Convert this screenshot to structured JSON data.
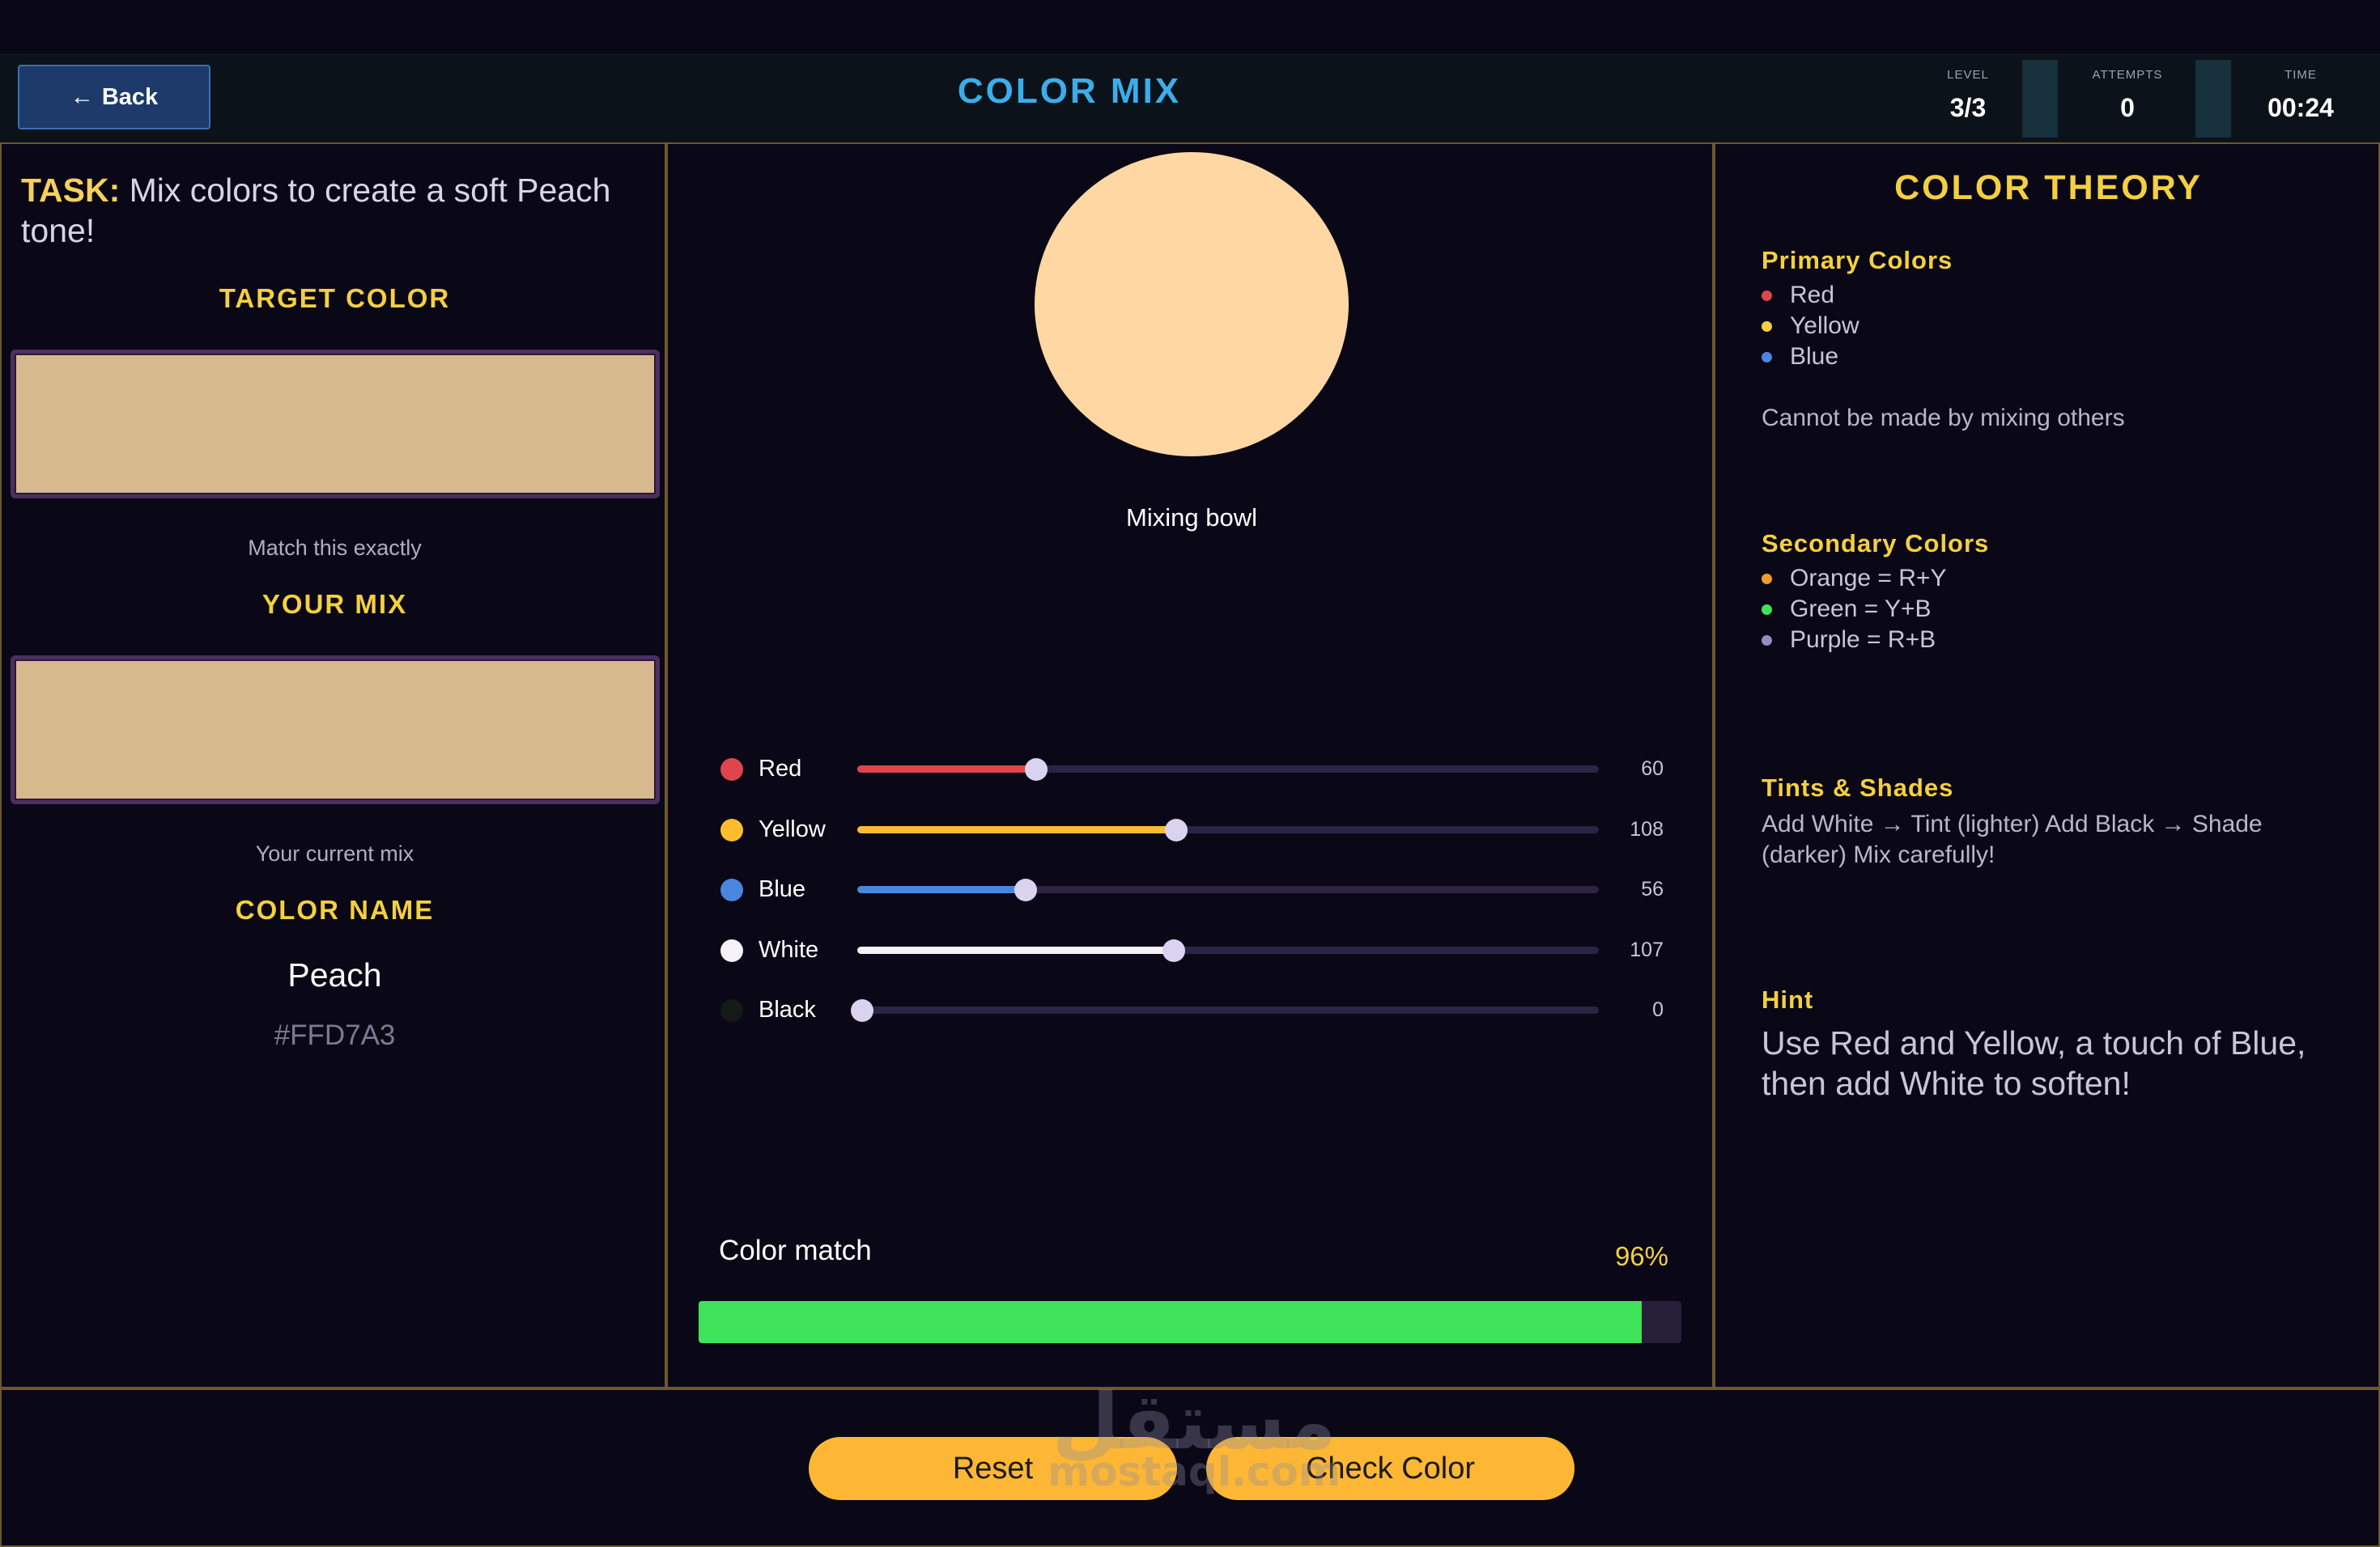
{
  "header": {
    "back_label": "Back",
    "back_icon": "←",
    "title": "COLOR MIX",
    "stats": [
      {
        "label": "LEVEL",
        "value": "3/3"
      },
      {
        "label": "ATTEMPTS",
        "value": "0"
      },
      {
        "label": "TIME",
        "value": "00:24"
      }
    ]
  },
  "left": {
    "task_prefix": "TASK:",
    "task_text": "Mix colors to create a soft Peach tone!",
    "target_heading": "TARGET COLOR",
    "target_color": "#d6b98c",
    "target_caption": "Match this exactly",
    "mix_heading": "YOUR MIX",
    "mix_color": "#d6b98c",
    "mix_caption": "Your current mix",
    "name_heading": "COLOR NAME",
    "color_name": "Peach",
    "color_hex": "#FFD7A3"
  },
  "center": {
    "bowl_color": "#ffd7a3",
    "bowl_label": "Mixing bowl",
    "sliders": [
      {
        "name": "Red",
        "value": "60",
        "color": "#e0454c",
        "fill": 0.235
      },
      {
        "name": "Yellow",
        "value": "108",
        "color": "#fbbd2e",
        "fill": 0.424
      },
      {
        "name": "Blue",
        "value": "56",
        "color": "#4a86e0",
        "fill": 0.22
      },
      {
        "name": "White",
        "value": "107",
        "color": "#f4f2f8",
        "fill": 0.42
      },
      {
        "name": "Black",
        "value": "0",
        "color": "#131a18",
        "fill": 0.0
      }
    ],
    "match_label": "Color match",
    "match_percent": "96%",
    "match_value": 0.96
  },
  "theory": {
    "title": "COLOR THEORY",
    "primary_heading": "Primary Colors",
    "primary_items": [
      {
        "label": "Red",
        "color": "#e0454c"
      },
      {
        "label": "Yellow",
        "color": "#f4d03f"
      },
      {
        "label": "Blue",
        "color": "#4a86e0"
      }
    ],
    "primary_note": "Cannot be made by mixing others",
    "secondary_heading": "Secondary Colors",
    "secondary_items": [
      {
        "label": "Orange = R+Y",
        "color": "#f39c2a"
      },
      {
        "label": "Green = Y+B",
        "color": "#3fe35a"
      },
      {
        "label": "Purple = R+B",
        "color": "#9a8ac0"
      }
    ],
    "tints_heading": "Tints & Shades",
    "tints_text": "Add White → Tint (lighter) Add Black → Shade (darker) Mix carefully!",
    "hint_heading": "Hint",
    "hint_text": "Use Red and Yellow, a touch of Blue, then add White to soften!"
  },
  "footer": {
    "reset_label": "Reset",
    "check_label": "Check Color"
  },
  "watermark": {
    "arabic": "مستقل",
    "latin": "mostaql.com"
  }
}
